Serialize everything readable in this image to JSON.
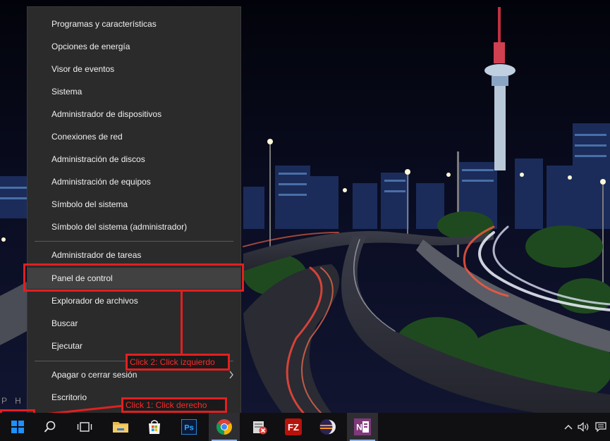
{
  "menu": {
    "items": [
      {
        "label": "Programas y características"
      },
      {
        "label": "Opciones de energía"
      },
      {
        "label": "Visor de eventos"
      },
      {
        "label": "Sistema"
      },
      {
        "label": "Administrador de dispositivos"
      },
      {
        "label": "Conexiones de red"
      },
      {
        "label": "Administración de discos"
      },
      {
        "label": "Administración de equipos"
      },
      {
        "label": "Símbolo del sistema"
      },
      {
        "label": "Símbolo del sistema (administrador)"
      },
      {
        "label": "Administrador de tareas"
      },
      {
        "label": "Panel de control"
      },
      {
        "label": "Explorador de archivos"
      },
      {
        "label": "Buscar"
      },
      {
        "label": "Ejecutar"
      },
      {
        "label": "Apagar o cerrar sesión"
      },
      {
        "label": "Escritorio"
      }
    ],
    "highlighted": "Panel de control"
  },
  "annotations": {
    "click2": "Click 2: Click izquierdo",
    "click1": "Click 1: Click derecho",
    "color": "#e02020"
  },
  "desktop": {
    "edge_text": "P H"
  },
  "taskbar": {
    "apps": [
      "start-icon",
      "search-icon",
      "task-view-icon",
      "file-explorer-icon",
      "store-icon",
      "photoshop-icon",
      "chrome-icon",
      "app-icon",
      "filezilla-icon",
      "eclipse-icon",
      "onenote-icon"
    ],
    "photoshop_label": "Ps",
    "filezilla_label": "FZ",
    "onenote_label": "N",
    "tray": [
      "chevron-up-icon",
      "volume-icon",
      "action-center-icon"
    ]
  }
}
